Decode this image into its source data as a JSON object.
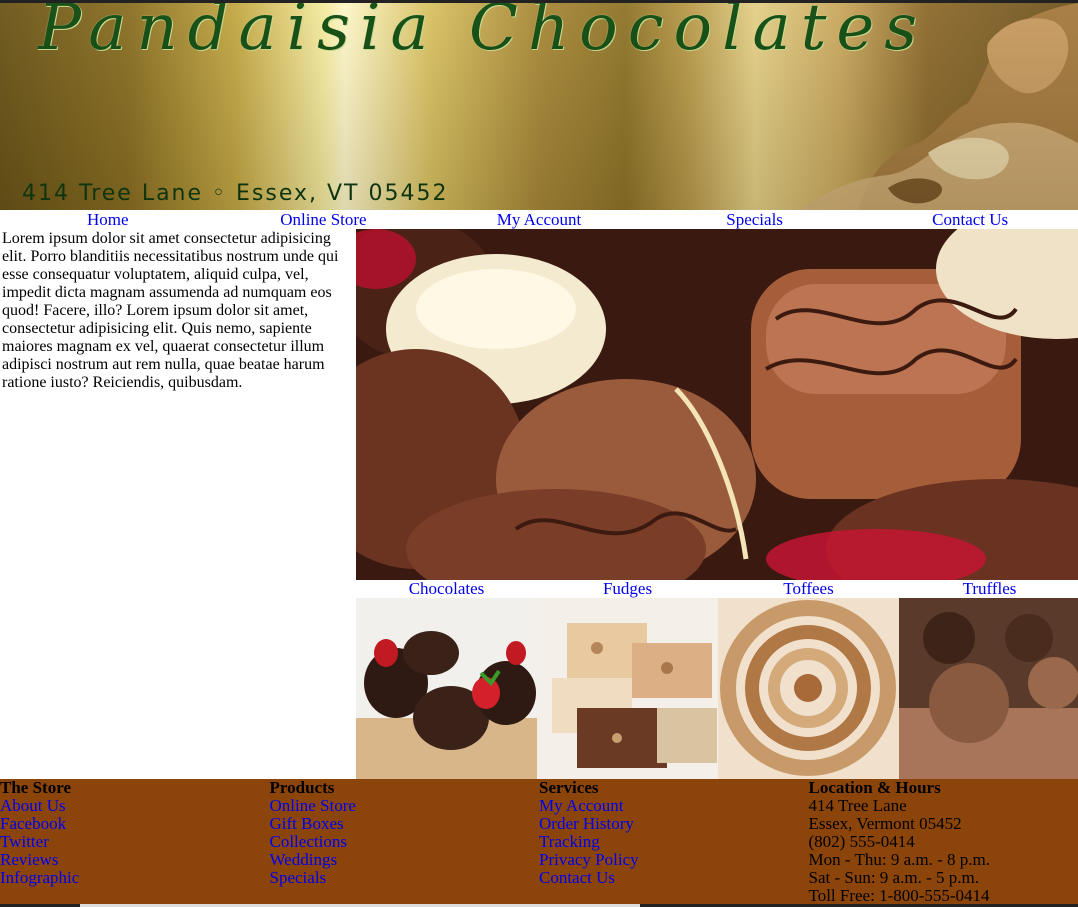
{
  "header": {
    "brand": "Pandaisia Chocolates",
    "address": "414 Tree Lane ◦ Essex, VT 05452"
  },
  "nav": [
    "Home",
    "Online Store",
    "My Account",
    "Specials",
    "Contact Us"
  ],
  "intro": "Lorem ipsum dolor sit amet consectetur adipisicing elit. Porro blanditiis necessitatibus nostrum unde qui esse consequatur voluptatem, aliquid culpa, vel, impedit dicta magnam assumenda ad numquam eos quod! Facere, illo? Lorem ipsum dolor sit amet, consectetur adipisicing elit. Quis nemo, sapiente maiores magnam ex vel, quaerat consectetur illum adipisci nostrum aut rem nulla, quae beatae harum ratione iusto? Reiciendis, quibusdam.",
  "categories": [
    "Chocolates",
    "Fudges",
    "Toffees",
    "Truffles"
  ],
  "footer": {
    "store": {
      "heading": "The Store",
      "links": [
        "About Us",
        "Facebook",
        "Twitter",
        "Reviews",
        "Infographic"
      ]
    },
    "products": {
      "heading": "Products",
      "links": [
        "Online Store",
        "Gift Boxes",
        "Collections",
        "Weddings",
        "Specials"
      ]
    },
    "services": {
      "heading": "Services",
      "links": [
        "My Account",
        "Order History",
        "Tracking",
        "Privacy Policy",
        "Contact Us"
      ]
    },
    "location": {
      "heading": "Location & Hours",
      "lines": [
        "414 Tree Lane",
        "Essex, Vermont 05452",
        "(802) 555-0414",
        "Mon - Thu: 9 a.m. - 8 p.m.",
        "Sat - Sun: 9 a.m. - 5 p.m.",
        "Toll Free: 1-800-555-0414"
      ]
    }
  }
}
